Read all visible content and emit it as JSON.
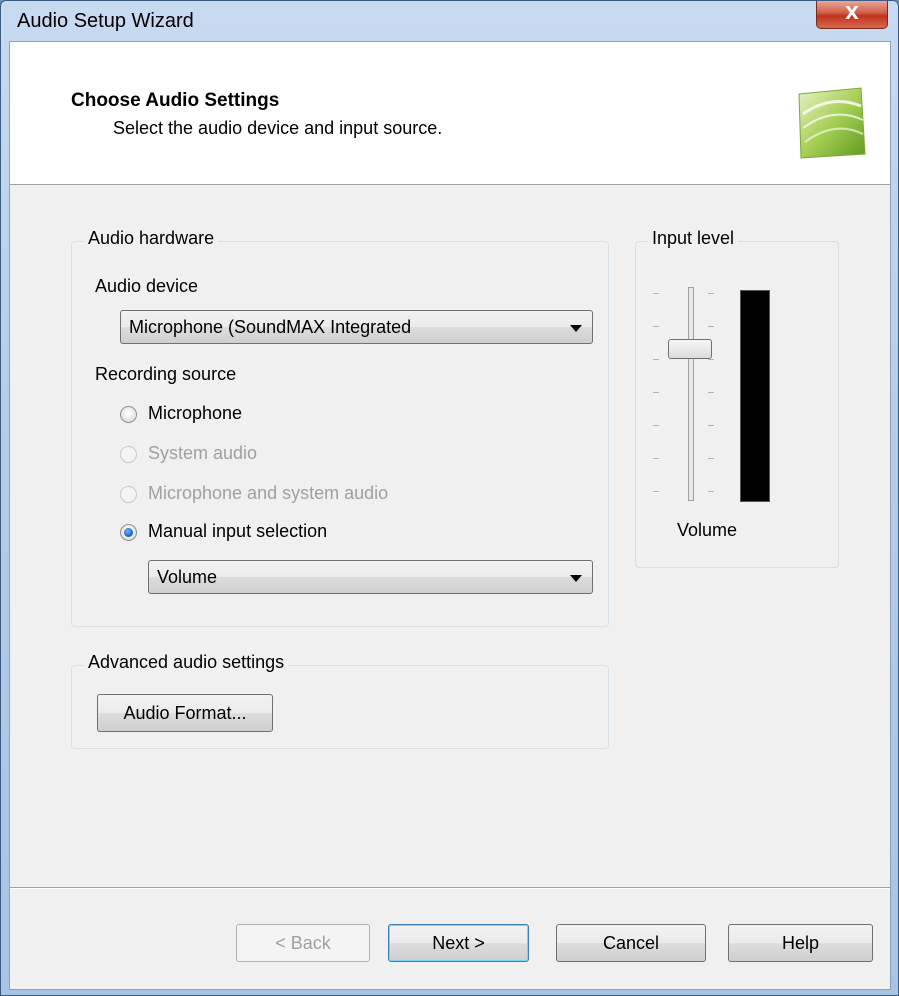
{
  "window": {
    "title": "Audio Setup Wizard",
    "close_glyph": "X"
  },
  "header": {
    "title": "Choose Audio Settings",
    "subtitle": "Select the audio device and input source.",
    "icon": "wizard-logo-icon"
  },
  "audio_hardware": {
    "group_label": "Audio hardware",
    "device_label": "Audio device",
    "device_value": "Microphone (SoundMAX Integrated",
    "recording_source_label": "Recording source",
    "options": [
      {
        "label": "Microphone",
        "selected": false,
        "enabled": true
      },
      {
        "label": "System audio",
        "selected": false,
        "enabled": false
      },
      {
        "label": "Microphone and system audio",
        "selected": false,
        "enabled": false
      },
      {
        "label": "Manual input selection",
        "selected": true,
        "enabled": true
      }
    ],
    "manual_input_value": "Volume"
  },
  "input_level": {
    "group_label": "Input level",
    "slider_label": "Volume"
  },
  "advanced": {
    "group_label": "Advanced audio settings",
    "format_button": "Audio Format..."
  },
  "footer": {
    "back": "< Back",
    "next": "Next >",
    "cancel": "Cancel",
    "help": "Help"
  },
  "colors": {
    "radio_dot": "#1a5fb4",
    "close_button": "#c0321c",
    "meter": "#000000"
  }
}
